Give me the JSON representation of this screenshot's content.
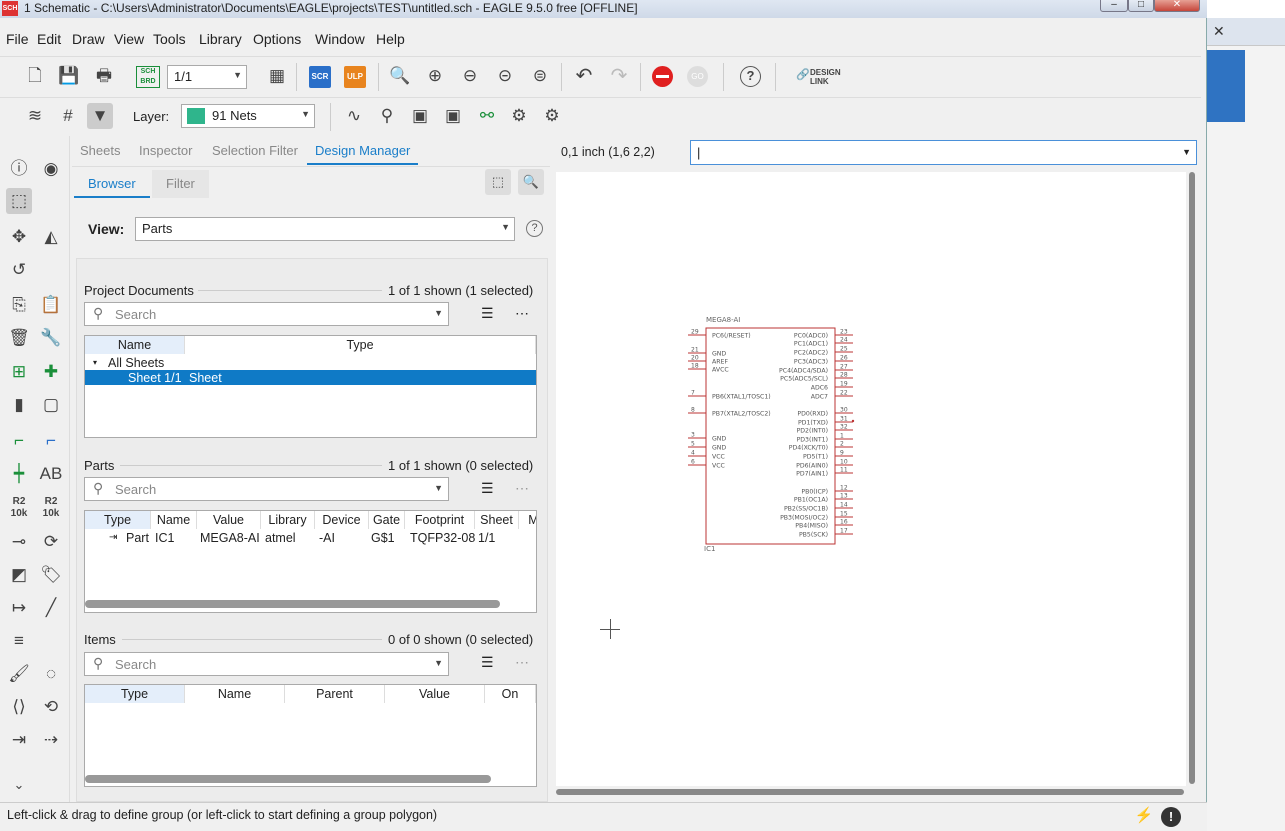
{
  "window": {
    "title": "1 Schematic - C:\\Users\\Administrator\\Documents\\EAGLE\\projects\\TEST\\untitled.sch - EAGLE 9.5.0 free [OFFLINE]",
    "icon": "SCH"
  },
  "menu": [
    "File",
    "Edit",
    "Draw",
    "View",
    "Tools",
    "Library",
    "Options",
    "Window",
    "Help"
  ],
  "toolbar": {
    "sheet_value": "1/1",
    "brd_label": "SCH BRD",
    "scr_label": "SCR",
    "ulp_label": "ULP",
    "design_link": "DESIGN LINK"
  },
  "toolbar2": {
    "layer_label": "Layer:",
    "layer_value": "91 Nets",
    "layer_color": "#2fb58c"
  },
  "panel": {
    "tabs": [
      "Sheets",
      "Inspector",
      "Selection Filter",
      "Design Manager"
    ],
    "active_tab": "Design Manager",
    "subtabs": [
      "Browser",
      "Filter"
    ],
    "view_label": "View:",
    "view_value": "Parts",
    "project_docs": {
      "title": "Project Documents",
      "count": "1 of 1 shown (1 selected)",
      "search_placeholder": "Search",
      "columns": [
        "Name",
        "Type"
      ],
      "rows": [
        {
          "name": "All Sheets",
          "type": ""
        },
        {
          "name": "Sheet 1/1",
          "type": "Sheet"
        }
      ]
    },
    "parts": {
      "title": "Parts",
      "count": "1 of 1 shown (0 selected)",
      "search_placeholder": "Search",
      "columns": [
        "Type",
        "Name",
        "Value",
        "Library",
        "Device",
        "Gate",
        "Footprint",
        "Sheet",
        "M"
      ],
      "rows": [
        {
          "type": "Part",
          "name": "IC1",
          "value": "MEGA8-AI",
          "library": "atmel",
          "device": "-AI",
          "gate": "G$1",
          "footprint": "TQFP32-08",
          "sheet": "1/1"
        }
      ]
    },
    "items": {
      "title": "Items",
      "count": "0 of 0 shown (0 selected)",
      "search_placeholder": "Search",
      "columns": [
        "Type",
        "Name",
        "Parent",
        "Value",
        "On"
      ]
    }
  },
  "coords": "0,1 inch (1,6 2,2)",
  "command_value": "|",
  "status": "Left-click & drag to define group (or left-click to start defining a group polygon)",
  "chip": {
    "name": "MEGA8-AI",
    "ref": "IC1",
    "left_pins": [
      {
        "num": "29",
        "label": "PC6(/RESET)"
      },
      {
        "num": "21",
        "label": "GND"
      },
      {
        "num": "20",
        "label": "AREF"
      },
      {
        "num": "18",
        "label": "AVCC"
      },
      {
        "num": "7",
        "label": "PB6(XTAL1/TOSC1)"
      },
      {
        "num": "8",
        "label": "PB7(XTAL2/TOSC2)"
      },
      {
        "num": "3",
        "label": "GND"
      },
      {
        "num": "5",
        "label": "GND"
      },
      {
        "num": "4",
        "label": "VCC"
      },
      {
        "num": "6",
        "label": "VCC"
      }
    ],
    "right_pins": [
      {
        "num": "23",
        "label": "PC0(ADC0)"
      },
      {
        "num": "24",
        "label": "PC1(ADC1)"
      },
      {
        "num": "25",
        "label": "PC2(ADC2)"
      },
      {
        "num": "26",
        "label": "PC3(ADC3)"
      },
      {
        "num": "27",
        "label": "PC4(ADC4/SDA)"
      },
      {
        "num": "28",
        "label": "PC5(ADC5/SCL)"
      },
      {
        "num": "19",
        "label": "ADC6"
      },
      {
        "num": "22",
        "label": "ADC7"
      },
      {
        "num": "30",
        "label": "PD0(RXD)"
      },
      {
        "num": "31",
        "label": "PD1(TXD)"
      },
      {
        "num": "32",
        "label": "PD2(INT0)"
      },
      {
        "num": "1",
        "label": "PD3(INT1)"
      },
      {
        "num": "2",
        "label": "PD4(XCK/T0)"
      },
      {
        "num": "9",
        "label": "PD5(T1)"
      },
      {
        "num": "10",
        "label": "PD6(AIN0)"
      },
      {
        "num": "11",
        "label": "PD7(AIN1)"
      },
      {
        "num": "12",
        "label": "PB0(ICP)"
      },
      {
        "num": "13",
        "label": "PB1(OC1A)"
      },
      {
        "num": "14",
        "label": "PB2(SS/OC1B)"
      },
      {
        "num": "15",
        "label": "PB3(MOSI/OC2)"
      },
      {
        "num": "16",
        "label": "PB4(MISO)"
      },
      {
        "num": "17",
        "label": "PB5(SCK)"
      }
    ]
  }
}
